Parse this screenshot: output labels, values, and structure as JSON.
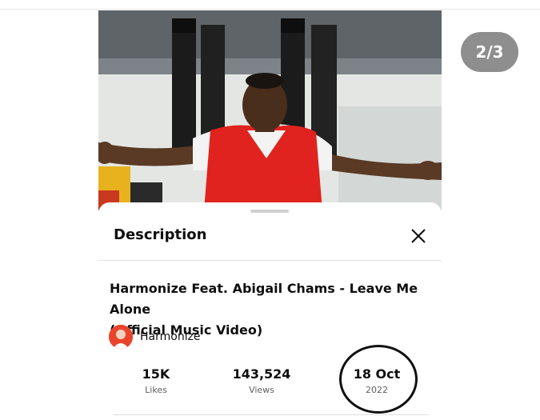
{
  "pager": {
    "counter": "2/3"
  },
  "sheet": {
    "title": "Description",
    "close_icon": "close-icon"
  },
  "video": {
    "title_line1": "Harmonize Feat. Abigail Chams - Leave Me Alone",
    "title_line2": "(Official Music Video)"
  },
  "channel": {
    "name": "Harmonize",
    "avatar_color": "#e8452c"
  },
  "stats": {
    "likes": {
      "value": "15K",
      "label": "Likes"
    },
    "views": {
      "value": "143,524",
      "label": "Views"
    },
    "date": {
      "value": "18 Oct",
      "label": "2022"
    }
  },
  "colors": {
    "shirt_red": "#e0231f",
    "counter_bg": "#8e8e8e"
  }
}
